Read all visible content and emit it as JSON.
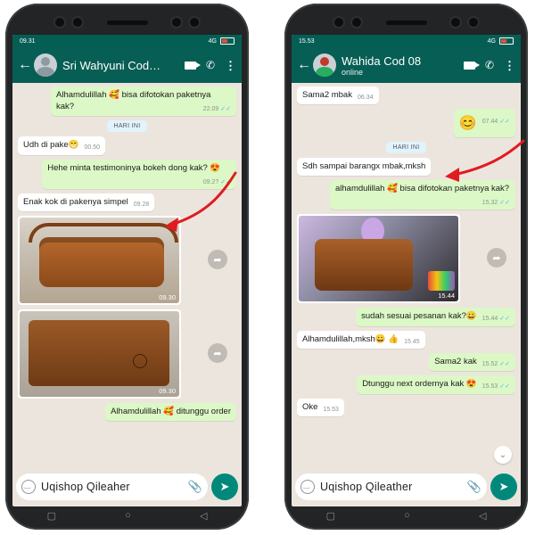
{
  "left": {
    "statusbar": {
      "time": "09.31",
      "signal": "4G",
      "battery": ""
    },
    "contact_name": "Sri Wahyuni Cod…",
    "messages": [
      {
        "dir": "out",
        "text": "Alhamdulillah 🥰 bisa difotokan paketnya kak?",
        "time": "22.09",
        "ticks": "✓✓"
      },
      {
        "dir": "day",
        "text": "HARI INI"
      },
      {
        "dir": "in",
        "text": "Udh di pake😁",
        "time": "00.50"
      },
      {
        "dir": "out",
        "text": "Hehe minta testimoninya bokeh dong kak? 😍",
        "time": "09.2?",
        "ticks": "✓✓"
      },
      {
        "dir": "in",
        "text": "Enak kok di pakenya simpel",
        "time": "09.28"
      },
      {
        "dir": "photo",
        "time": "09.30"
      },
      {
        "dir": "photo",
        "time": "09.30"
      },
      {
        "dir": "out",
        "text": "Alhamdulillah 🥰 ditunggu order",
        "time": "",
        "ticks": ""
      }
    ],
    "input_text": "Uqishop Qileaher"
  },
  "right": {
    "statusbar": {
      "time": "15.53",
      "signal": "4G",
      "battery": ""
    },
    "contact_name": "Wahida Cod 08",
    "contact_status": "online",
    "messages": [
      {
        "dir": "in",
        "text": "Sama2 mbak",
        "time": "06.34"
      },
      {
        "dir": "out",
        "text": "😊",
        "time": "07.44",
        "ticks": "✓✓"
      },
      {
        "dir": "day",
        "text": "HARI INI"
      },
      {
        "dir": "in",
        "text": "Sdh sampai barangx mbak,mksh",
        "time": ""
      },
      {
        "dir": "out",
        "text": "alhamdulillah 🥰 bisa difotokan paketnya kak?",
        "time": "15.32",
        "ticks": "✓✓"
      },
      {
        "dir": "photo",
        "time": "15.44"
      },
      {
        "dir": "out",
        "text": "sudah sesuai pesanan kak?😀",
        "time": "15.44",
        "ticks": "✓✓"
      },
      {
        "dir": "in",
        "text": "Alhamdulillah,mksh😀 👍",
        "time": "15.45"
      },
      {
        "dir": "out",
        "text": "Sama2 kak",
        "time": "15.52",
        "ticks": "✓✓"
      },
      {
        "dir": "out",
        "text": "Dtunggu next ordernya kak 😍",
        "time": "15.53",
        "ticks": "✓✓"
      },
      {
        "dir": "in",
        "text": "Oke",
        "time": "15.53"
      }
    ],
    "input_text": "Uqishop Qileather"
  },
  "icons": {
    "back": "back-arrow-icon",
    "video": "video-call-icon",
    "call": "phone-call-icon",
    "menu": "more-vert-icon",
    "emoji": "emoji-icon",
    "attach": "attach-icon",
    "send": "send-icon",
    "forward": "forward-icon",
    "nav_recents": "recents-icon",
    "nav_home": "home-icon",
    "nav_back": "nav-back-icon"
  },
  "colors": {
    "header": "#075e54",
    "outgoing": "#dcf8c6",
    "incoming": "#ffffff",
    "background": "#ece5dd",
    "send_button": "#00897b",
    "annotation_arrow": "#e01b22"
  }
}
